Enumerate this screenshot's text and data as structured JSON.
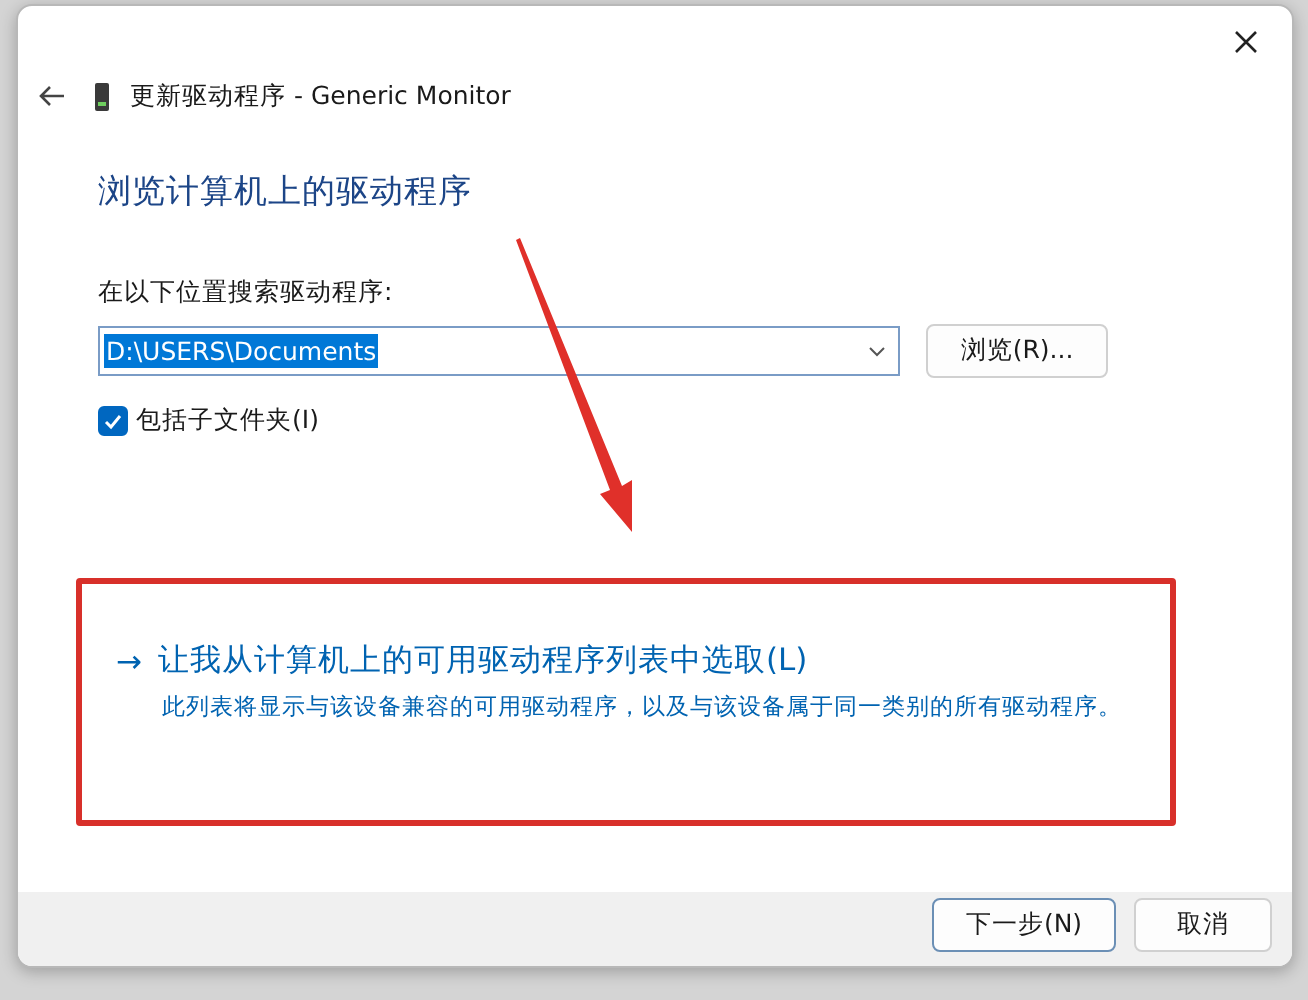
{
  "window": {
    "title": "更新驱动程序 - Generic Monitor"
  },
  "heading": "浏览计算机上的驱动程序",
  "search": {
    "label": "在以下位置搜索驱动程序:",
    "value": "D:\\USERS\\Documents",
    "text_selected": true,
    "browse_button": "浏览(R)..."
  },
  "include_subfolders": {
    "label": "包括子文件夹(I)",
    "checked": true
  },
  "pick_option": {
    "arrow": "→",
    "label": "让我从计算机上的可用驱动程序列表中选取(L)",
    "description": "此列表将显示与该设备兼容的可用驱动程序，以及与该设备属于同一类别的所有驱动程序。",
    "highlighted": true
  },
  "buttons": [
    {
      "label": "下一步(N)",
      "default": true
    },
    {
      "label": "取消",
      "default": false
    }
  ]
}
